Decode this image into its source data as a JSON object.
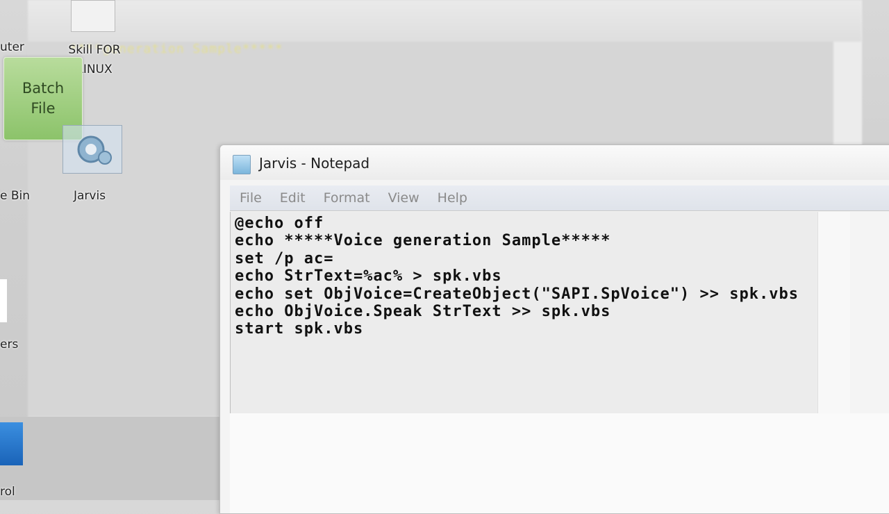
{
  "background": {
    "blurred_text": "****generation Sample*****"
  },
  "desktop": {
    "icons": [
      {
        "label": "uter"
      },
      {
        "label": "Skill FOR\nLINUX"
      },
      {
        "label": "Batch\nFile"
      },
      {
        "label": "Jarvis"
      },
      {
        "label": "e Bin"
      },
      {
        "label": "ers"
      },
      {
        "label": "rol"
      }
    ]
  },
  "notepad": {
    "title": "Jarvis - Notepad",
    "menu": [
      "File",
      "Edit",
      "Format",
      "View",
      "Help"
    ],
    "lines": [
      "@echo off",
      "echo *****Voice generation Sample*****",
      "set /p ac=",
      "echo StrText=%ac% > spk.vbs",
      "echo set ObjVoice=CreateObject(\"SAPI.SpVoice\") >> spk.vbs",
      "echo ObjVoice.Speak StrText >> spk.vbs",
      "start spk.vbs"
    ]
  },
  "colors": {
    "batch_tile": "#8cc36a",
    "menubar": "#e3e6ec"
  }
}
